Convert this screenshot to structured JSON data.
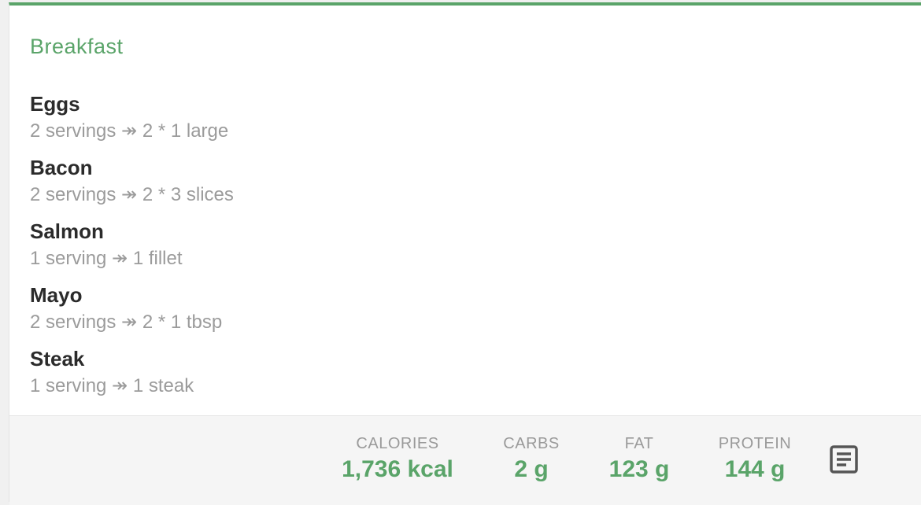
{
  "meal": {
    "title": "Breakfast",
    "accent_color": "#5aa469"
  },
  "foods": [
    {
      "name": "Eggs",
      "detail": "2 servings ↠ 2 * 1 large"
    },
    {
      "name": "Bacon",
      "detail": "2 servings ↠ 2 * 3 slices"
    },
    {
      "name": "Salmon",
      "detail": "1 serving ↠ 1 fillet"
    },
    {
      "name": "Mayo",
      "detail": "2 servings ↠ 2 * 1 tbsp"
    },
    {
      "name": "Steak",
      "detail": "1 serving ↠ 1 steak"
    }
  ],
  "totals": {
    "calories": {
      "label": "CALORIES",
      "value": "1,736 kcal"
    },
    "carbs": {
      "label": "CARBS",
      "value": "2 g"
    },
    "fat": {
      "label": "FAT",
      "value": "123 g"
    },
    "protein": {
      "label": "PROTEIN",
      "value": "144 g"
    }
  },
  "icons": {
    "notes": "notes-icon"
  }
}
